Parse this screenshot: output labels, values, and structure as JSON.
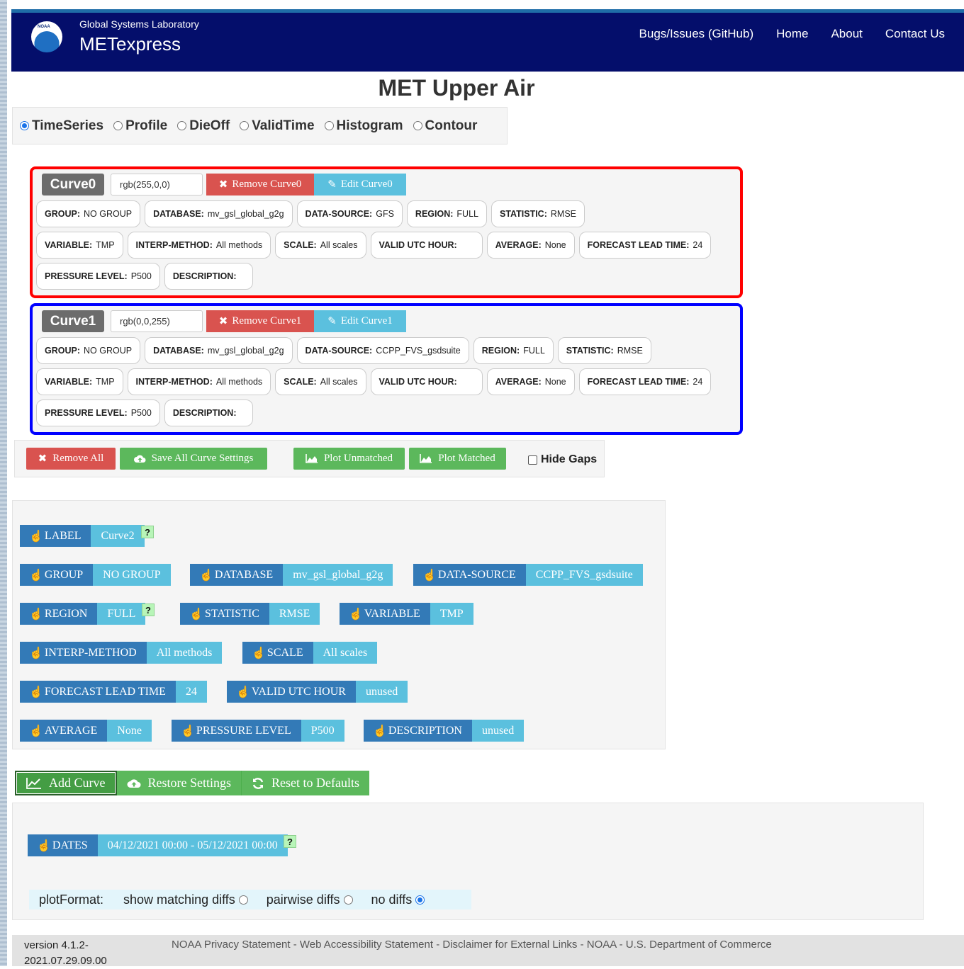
{
  "navbar": {
    "logo_text": "NOAA",
    "lab": "Global Systems Laboratory",
    "app": "METexpress",
    "links": [
      "Bugs/Issues (GitHub)",
      "Home",
      "About",
      "Contact Us"
    ]
  },
  "page_title": "MET Upper Air",
  "plot_types": [
    {
      "label": "TimeSeries",
      "selected": true
    },
    {
      "label": "Profile",
      "selected": false
    },
    {
      "label": "DieOff",
      "selected": false
    },
    {
      "label": "ValidTime",
      "selected": false
    },
    {
      "label": "Histogram",
      "selected": false
    },
    {
      "label": "Contour",
      "selected": false
    }
  ],
  "curves": [
    {
      "label": "Curve0",
      "color": "rgb(255,0,0)",
      "border_color": "#ff0000",
      "remove": "Remove Curve0",
      "edit": "Edit Curve0",
      "rows": [
        [
          {
            "k": "GROUP:",
            "v": "NO GROUP"
          },
          {
            "k": "DATABASE:",
            "v": "mv_gsl_global_g2g"
          },
          {
            "k": "DATA-SOURCE:",
            "v": "GFS"
          },
          {
            "k": "REGION:",
            "v": "FULL"
          },
          {
            "k": "STATISTIC:",
            "v": "RMSE"
          }
        ],
        [
          {
            "k": "VARIABLE:",
            "v": "TMP"
          },
          {
            "k": "INTERP-METHOD:",
            "v": "All methods"
          },
          {
            "k": "SCALE:",
            "v": "All scales"
          },
          {
            "k": "VALID UTC HOUR:",
            "v": ""
          },
          {
            "k": "AVERAGE:",
            "v": "None"
          },
          {
            "k": "FORECAST LEAD TIME:",
            "v": "24"
          }
        ],
        [
          {
            "k": "PRESSURE LEVEL:",
            "v": "P500"
          },
          {
            "k": "DESCRIPTION:",
            "v": ""
          }
        ]
      ]
    },
    {
      "label": "Curve1",
      "color": "rgb(0,0,255)",
      "border_color": "#0000ff",
      "remove": "Remove Curve1",
      "edit": "Edit Curve1",
      "rows": [
        [
          {
            "k": "GROUP:",
            "v": "NO GROUP"
          },
          {
            "k": "DATABASE:",
            "v": "mv_gsl_global_g2g"
          },
          {
            "k": "DATA-SOURCE:",
            "v": "CCPP_FVS_gsdsuite"
          },
          {
            "k": "REGION:",
            "v": "FULL"
          },
          {
            "k": "STATISTIC:",
            "v": "RMSE"
          }
        ],
        [
          {
            "k": "VARIABLE:",
            "v": "TMP"
          },
          {
            "k": "INTERP-METHOD:",
            "v": "All methods"
          },
          {
            "k": "SCALE:",
            "v": "All scales"
          },
          {
            "k": "VALID UTC HOUR:",
            "v": ""
          },
          {
            "k": "AVERAGE:",
            "v": "None"
          },
          {
            "k": "FORECAST LEAD TIME:",
            "v": "24"
          }
        ],
        [
          {
            "k": "PRESSURE LEVEL:",
            "v": "P500"
          },
          {
            "k": "DESCRIPTION:",
            "v": ""
          }
        ]
      ]
    }
  ],
  "actions": {
    "remove_all": "Remove All",
    "save_all": "Save All Curve Settings",
    "plot_unmatched": "Plot Unmatched",
    "plot_matched": "Plot Matched",
    "hide_gaps": "Hide Gaps"
  },
  "selectors": {
    "label": {
      "k": "LABEL",
      "v": "Curve2"
    },
    "group": {
      "k": "GROUP",
      "v": "NO GROUP"
    },
    "database": {
      "k": "DATABASE",
      "v": "mv_gsl_global_g2g"
    },
    "data_source": {
      "k": "DATA-SOURCE",
      "v": "CCPP_FVS_gsdsuite"
    },
    "region": {
      "k": "REGION",
      "v": "FULL"
    },
    "statistic": {
      "k": "STATISTIC",
      "v": "RMSE"
    },
    "variable": {
      "k": "VARIABLE",
      "v": "TMP"
    },
    "interp": {
      "k": "INTERP-METHOD",
      "v": "All methods"
    },
    "scale": {
      "k": "SCALE",
      "v": "All scales"
    },
    "lead": {
      "k": "FORECAST LEAD TIME",
      "v": "24"
    },
    "valid_hour": {
      "k": "VALID UTC HOUR",
      "v": "unused"
    },
    "average": {
      "k": "AVERAGE",
      "v": "None"
    },
    "pressure": {
      "k": "PRESSURE LEVEL",
      "v": "P500"
    },
    "description": {
      "k": "DESCRIPTION",
      "v": "unused"
    },
    "help": "?"
  },
  "bottom_buttons": {
    "add_curve": "Add Curve",
    "restore": "Restore Settings",
    "reset": "Reset to Defaults"
  },
  "dates": {
    "k": "DATES",
    "v": "04/12/2021 00:00 - 05/12/2021 00:00"
  },
  "plot_format": {
    "label": "plotFormat:",
    "options": [
      {
        "label": "show matching diffs",
        "selected": false
      },
      {
        "label": "pairwise diffs",
        "selected": false
      },
      {
        "label": "no diffs",
        "selected": true
      }
    ]
  },
  "footer": {
    "version": "version 4.1.2-2021.07.29.09.00",
    "links": "NOAA Privacy Statement - Web Accessibility Statement - Disclaimer for External Links - NOAA - U.S. Department of Commerce"
  },
  "colors": {
    "navbar": "#040e6b",
    "primary": "#337ab7",
    "info": "#5bc0de",
    "success": "#5cb85c",
    "danger": "#d9534f"
  }
}
